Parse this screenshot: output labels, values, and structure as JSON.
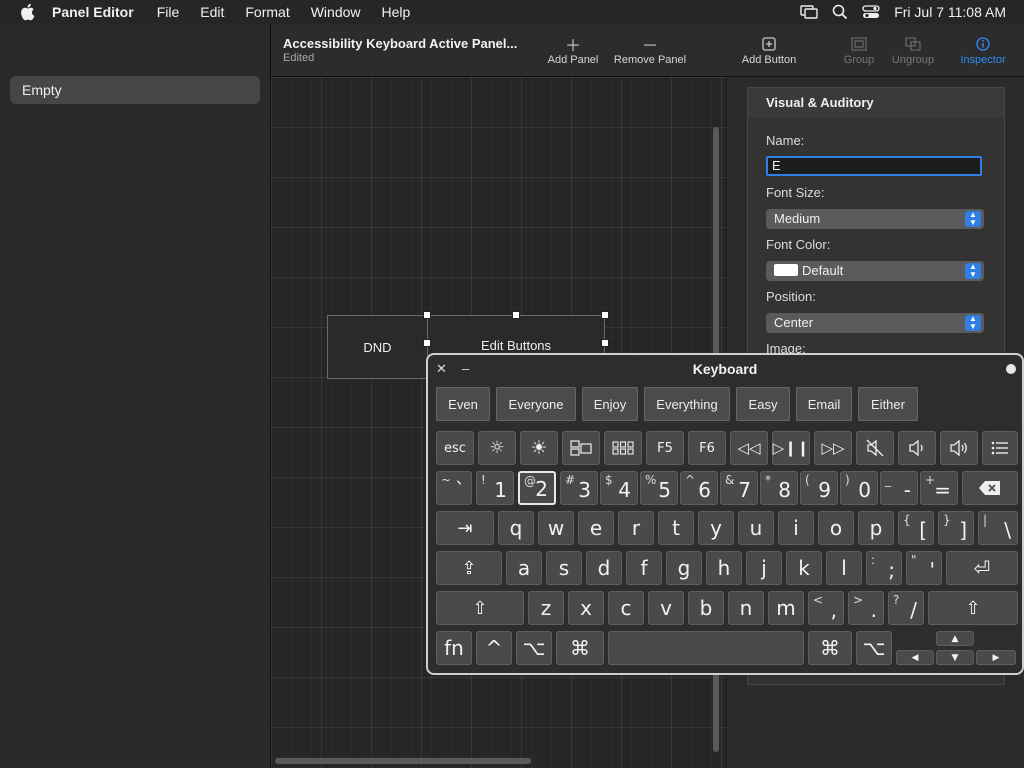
{
  "menubar": {
    "app_name": "Panel Editor",
    "items": [
      "File",
      "Edit",
      "Format",
      "Window",
      "Help"
    ],
    "datetime": "Fri Jul 7  11:08 AM"
  },
  "sidebar": {
    "items": [
      {
        "label": "Empty"
      }
    ]
  },
  "toolbar": {
    "doc_title": "Accessibility Keyboard Active Panel...",
    "doc_subtitle": "Edited",
    "add_panel": "Add Panel",
    "remove_panel": "Remove Panel",
    "add_button": "Add Button",
    "group": "Group",
    "ungroup": "Ungroup",
    "inspector": "Inspector"
  },
  "canvas": {
    "dnd_label": "DND",
    "edit_buttons_label": "Edit Buttons"
  },
  "inspector": {
    "section": "Visual & Auditory",
    "name_label": "Name:",
    "name_value": "E",
    "font_size_label": "Font Size:",
    "font_size_value": "Medium",
    "font_color_label": "Font Color:",
    "font_color_value": "Default",
    "position_label": "Position:",
    "position_value": "Center",
    "image_label": "Image:"
  },
  "keyboard": {
    "title": "Keyboard",
    "predictions": [
      "Even",
      "Everyone",
      "Enjoy",
      "Everything",
      "Easy",
      "Email",
      "Either"
    ],
    "fn_row": {
      "esc": "esc",
      "f5": "F5",
      "f6": "F6"
    },
    "number_row": [
      {
        "shift": "~",
        "main": "`"
      },
      {
        "shift": "!",
        "main": "1"
      },
      {
        "shift": "@",
        "main": "2"
      },
      {
        "shift": "#",
        "main": "3"
      },
      {
        "shift": "$",
        "main": "4"
      },
      {
        "shift": "%",
        "main": "5"
      },
      {
        "shift": "^",
        "main": "6"
      },
      {
        "shift": "&",
        "main": "7"
      },
      {
        "shift": "*",
        "main": "8"
      },
      {
        "shift": "(",
        "main": "9"
      },
      {
        "shift": ")",
        "main": "0"
      },
      {
        "shift": "_",
        "main": "-"
      },
      {
        "shift": "+",
        "main": "="
      }
    ],
    "q_row": [
      "q",
      "w",
      "e",
      "r",
      "t",
      "y",
      "u",
      "i",
      "o",
      "p"
    ],
    "q_row_sym": [
      {
        "shift": "{",
        "main": "["
      },
      {
        "shift": "}",
        "main": "]"
      },
      {
        "shift": "|",
        "main": "\\"
      }
    ],
    "a_row": [
      "a",
      "s",
      "d",
      "f",
      "g",
      "h",
      "j",
      "k",
      "l"
    ],
    "a_row_sym": [
      {
        "shift": ":",
        "main": ";"
      },
      {
        "shift": "\"",
        "main": "'"
      }
    ],
    "z_row": [
      "z",
      "x",
      "c",
      "v",
      "b",
      "n",
      "m"
    ],
    "z_row_sym": [
      {
        "shift": "<",
        "main": ","
      },
      {
        "shift": ">",
        "main": "."
      },
      {
        "shift": "?",
        "main": "/"
      }
    ],
    "bottom": {
      "fn": "fn",
      "ctrl": "^",
      "opt": "⌥",
      "cmd": "⌘"
    }
  }
}
